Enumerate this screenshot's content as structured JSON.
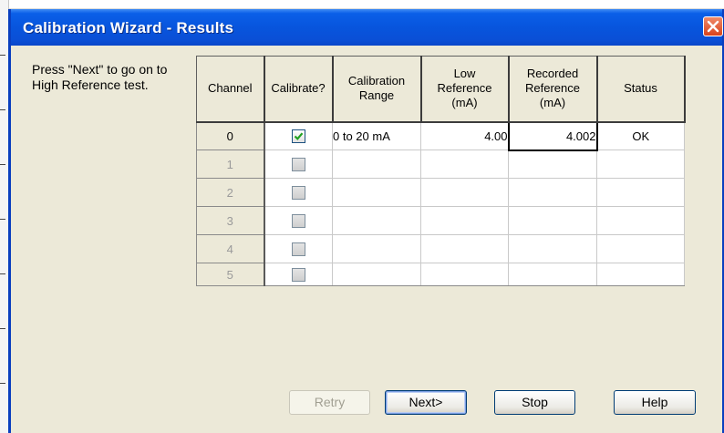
{
  "window": {
    "title": "Calibration Wizard - Results",
    "close_icon": "close-icon"
  },
  "instruction": "Press \"Next\" to go on to High Reference test.",
  "table": {
    "headers": {
      "channel": "Channel",
      "calibrate": "Calibrate?",
      "range_l1": "Calibration",
      "range_l2": "Range",
      "low_l1": "Low",
      "low_l2": "Reference",
      "low_l3": "(mA)",
      "rec_l1": "Recorded",
      "rec_l2": "Reference",
      "rec_l3": "(mA)",
      "status": "Status"
    },
    "rows": [
      {
        "channel": "0",
        "calibrate": true,
        "range": "0 to 20 mA",
        "low": "4.00",
        "recorded": "4.002",
        "status": "OK"
      },
      {
        "channel": "1",
        "calibrate": false,
        "range": "",
        "low": "",
        "recorded": "",
        "status": ""
      },
      {
        "channel": "2",
        "calibrate": false,
        "range": "",
        "low": "",
        "recorded": "",
        "status": ""
      },
      {
        "channel": "3",
        "calibrate": false,
        "range": "",
        "low": "",
        "recorded": "",
        "status": ""
      },
      {
        "channel": "4",
        "calibrate": false,
        "range": "",
        "low": "",
        "recorded": "",
        "status": ""
      },
      {
        "channel": "5",
        "calibrate": false,
        "range": "",
        "low": "",
        "recorded": "",
        "status": ""
      }
    ]
  },
  "buttons": {
    "retry": "Retry",
    "next": "Next>",
    "stop": "Stop",
    "help": "Help"
  },
  "colors": {
    "titlebar": "#0855dd",
    "dialog_bg": "#ece9d8",
    "checkmark": "#21a121",
    "close_button": "#d8431c"
  }
}
